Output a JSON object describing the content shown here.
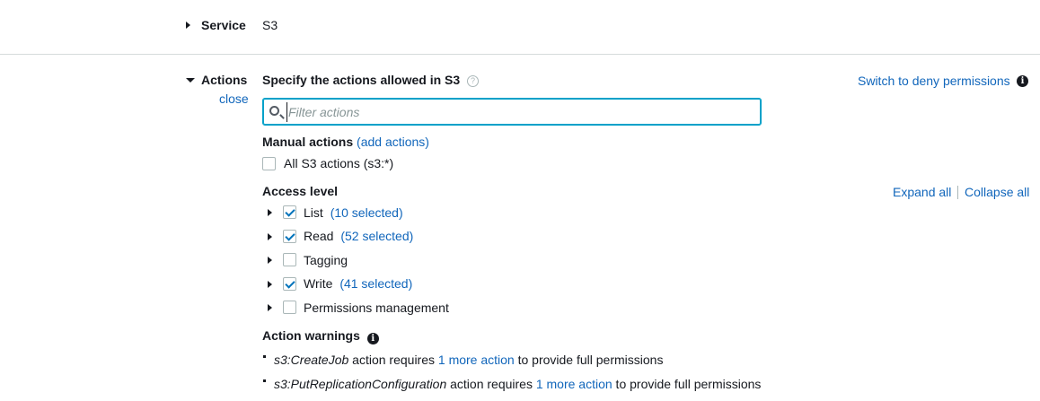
{
  "service": {
    "label": "Service",
    "value": "S3"
  },
  "actions": {
    "label": "Actions",
    "close_link": "close",
    "heading": "Specify the actions allowed in S3",
    "help_icon": "question-circle-icon",
    "switch_link": "Switch to deny permissions",
    "info_icon": "info-circle-icon",
    "filter": {
      "placeholder": "Filter actions",
      "value": ""
    },
    "manual": {
      "title": "Manual actions",
      "add_link": "(add actions)",
      "all_label": "All S3 actions (s3:*)",
      "all_checked": false
    },
    "access_level": {
      "title": "Access level",
      "expand_all": "Expand all",
      "collapse_all": "Collapse all",
      "items": [
        {
          "name": "List",
          "checked": true,
          "count_text": "(10 selected)"
        },
        {
          "name": "Read",
          "checked": true,
          "count_text": "(52 selected)"
        },
        {
          "name": "Tagging",
          "checked": false,
          "count_text": ""
        },
        {
          "name": "Write",
          "checked": true,
          "count_text": "(41 selected)"
        },
        {
          "name": "Permissions management",
          "checked": false,
          "count_text": ""
        }
      ]
    },
    "warnings": {
      "title": "Action warnings",
      "items": [
        {
          "action": "s3:CreateJob",
          "pre": " action requires ",
          "link": "1 more action",
          "post": " to provide full permissions"
        },
        {
          "action": "s3:PutReplicationConfiguration",
          "pre": " action requires ",
          "link": "1 more action",
          "post": " to provide full permissions"
        }
      ]
    }
  },
  "colors": {
    "link": "#1166bb",
    "focus": "#00a1c9",
    "check": "#0073bb",
    "divider": "#d5dbdb"
  }
}
